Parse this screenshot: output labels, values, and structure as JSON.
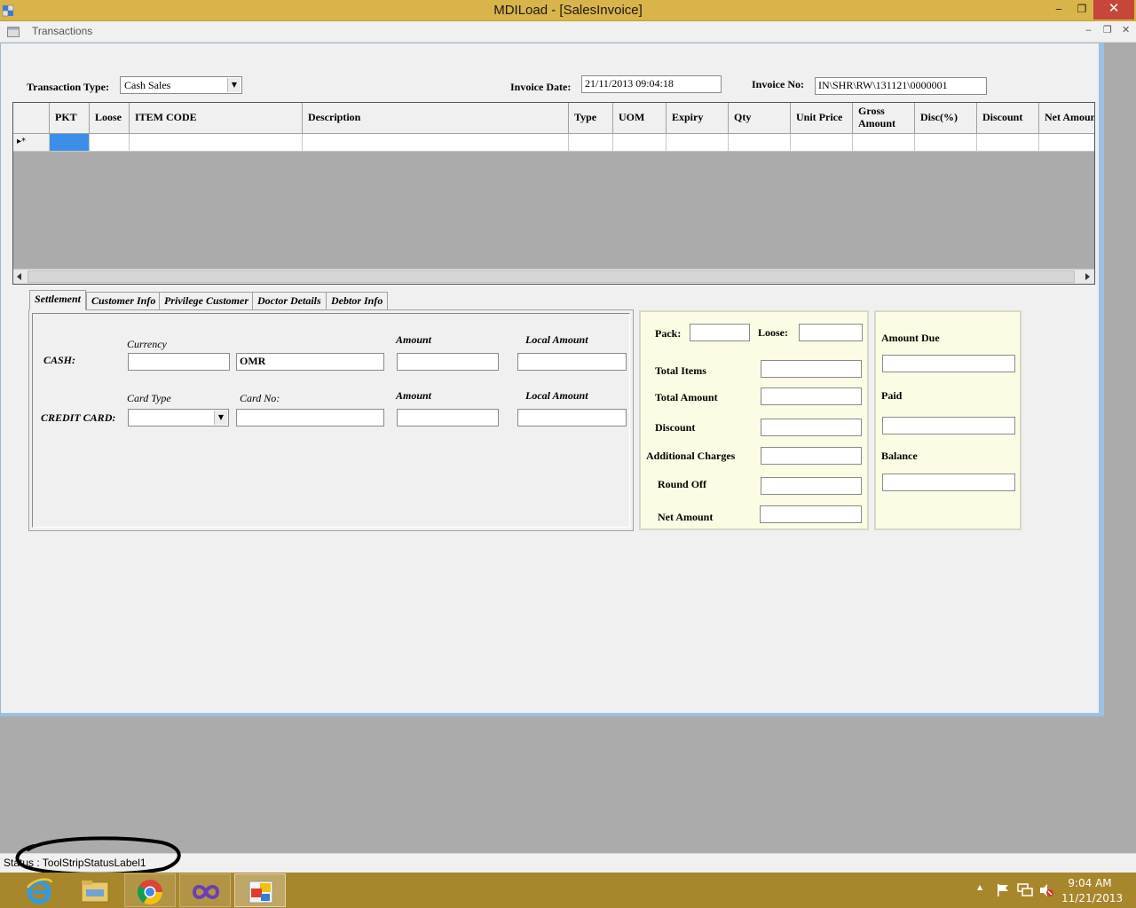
{
  "window": {
    "title": "MDILoad - [SalesInvoice]",
    "min_glyph": "‒",
    "restore_glyph": "❐",
    "close_glyph": "✕"
  },
  "menu": {
    "transactions": "Transactions",
    "mdi_min": "‒",
    "mdi_restore": "❐",
    "mdi_close": "✕"
  },
  "header": {
    "transaction_type_label": "Transaction Type:",
    "transaction_type_value": "Cash Sales",
    "invoice_date_label": "Invoice Date:",
    "invoice_date_value": "21/11/2013 09:04:18",
    "invoice_no_label": "Invoice No:",
    "invoice_no_value": "IN\\SHR\\RW\\131121\\0000001"
  },
  "grid": {
    "columns": [
      {
        "label": "PKT"
      },
      {
        "label": "Loose"
      },
      {
        "label": "ITEM CODE"
      },
      {
        "label": "Description"
      },
      {
        "label": "Type"
      },
      {
        "label": "UOM"
      },
      {
        "label": "Expiry"
      },
      {
        "label": "Qty"
      },
      {
        "label": "Unit Price"
      },
      {
        "label": "Gross Amount"
      },
      {
        "label": "Disc(%)"
      },
      {
        "label": "Discount"
      },
      {
        "label": "Net Amount"
      }
    ],
    "new_row_marker": "▸*"
  },
  "tabs": [
    "Settlement",
    "Customer Info",
    "Privilege Customer",
    "Doctor Details",
    "Debtor Info"
  ],
  "settlement": {
    "currency_label": "Currency",
    "amount_label": "Amount",
    "local_amount_label": "Local Amount",
    "cash_label": "CASH:",
    "currency_value": "OMR",
    "card_type_label": "Card Type",
    "card_no_label": "Card No:",
    "amount_label_2": "Amount",
    "local_amount_label_2": "Local Amount",
    "credit_card_label": "CREDIT CARD:"
  },
  "summary": {
    "pack_label": "Pack:",
    "loose_label": "Loose:",
    "total_items": "Total Items",
    "total_amount": "Total Amount",
    "discount": "Discount",
    "additional_charges": "Additional Charges",
    "round_off": "Round Off",
    "net_amount": "Net Amount"
  },
  "due": {
    "amount_due": "Amount Due",
    "paid": "Paid",
    "balance": "Balance"
  },
  "statusbar": {
    "text": "Status : ToolStripStatusLabel1"
  },
  "taskbar": {
    "apps": [
      "internet-explorer-icon",
      "file-explorer-icon",
      "chrome-icon",
      "visual-studio-icon",
      "mdiload-app-icon"
    ],
    "time": "9:04 AM",
    "date": "11/21/2013",
    "tray_up_arrow": "▲"
  },
  "colors": {
    "titlebar": "#d9b44a",
    "close": "#c7463a",
    "taskbar": "#a8862c",
    "selected_cell": "#3d8ee8",
    "summary_bg": "#fcfce4",
    "mdi_border": "#9cc1e2"
  }
}
